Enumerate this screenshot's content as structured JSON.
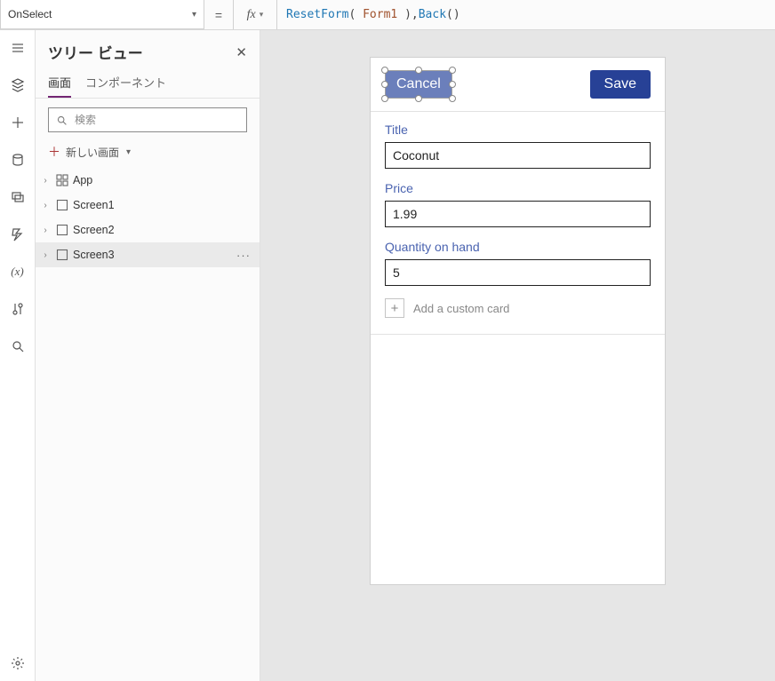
{
  "formula_bar": {
    "property": "OnSelect",
    "fx": "fx",
    "expression_tokens": {
      "t1": "ResetForm",
      "t2": "( ",
      "t3": "Form1",
      "t4": " )",
      "t5": ",",
      "t6": "Back",
      "t7": "()"
    }
  },
  "tree_panel": {
    "title": "ツリー ビュー",
    "tabs": {
      "screens": "画面",
      "components": "コンポーネント"
    },
    "search_placeholder": "検索",
    "new_screen": "新しい画面",
    "items": [
      {
        "label": "App",
        "kind": "app",
        "selected": false
      },
      {
        "label": "Screen1",
        "kind": "screen",
        "selected": false
      },
      {
        "label": "Screen2",
        "kind": "screen",
        "selected": false
      },
      {
        "label": "Screen3",
        "kind": "screen",
        "selected": true
      }
    ]
  },
  "device": {
    "cancel": "Cancel",
    "save": "Save",
    "fields": [
      {
        "label": "Title",
        "value": "Coconut"
      },
      {
        "label": "Price",
        "value": "1.99"
      },
      {
        "label": "Quantity on hand",
        "value": "5"
      }
    ],
    "add_card": "Add a custom card"
  }
}
